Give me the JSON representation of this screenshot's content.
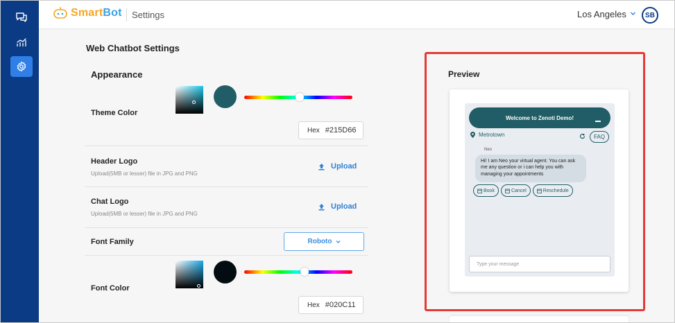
{
  "app": {
    "name_part1": "Smart",
    "name_part2": "Bot",
    "page": "Settings"
  },
  "topbar": {
    "location": "Los Angeles",
    "avatar_initials": "SB"
  },
  "sidebar": {
    "items": [
      {
        "icon": "chat-bubbles-icon",
        "active": false
      },
      {
        "icon": "analytics-chart-icon",
        "active": false
      },
      {
        "icon": "settings-gear-icon",
        "active": true
      }
    ]
  },
  "settings": {
    "title": "Web Chatbot Settings",
    "appearance_title": "Appearance",
    "theme_color": {
      "label": "Theme Color",
      "hex_label": "Hex",
      "hex_value": "#215D66",
      "swatch": "#215D66"
    },
    "header_logo": {
      "label": "Header Logo",
      "hint": "Upload(5MB or lesser) file in JPG and PNG",
      "button": "Upload"
    },
    "chat_logo": {
      "label": "Chat Logo",
      "hint": "Upload(5MB or lesser) file in JPG and PNG",
      "button": "Upload"
    },
    "font_family": {
      "label": "Font Family",
      "value": "Roboto"
    },
    "font_color": {
      "label": "Font Color",
      "hex_label": "Hex",
      "hex_value": "#020C11",
      "swatch": "#020C11"
    }
  },
  "preview": {
    "title": "Preview",
    "header_text": "Welcome to Zenoti Demo!",
    "location": "Metrotown",
    "faq": "FAQ",
    "agent_name": "Neo",
    "message": "Hi! I am Neo your virtual agent. You can ask me any question or i can help you with managing your appointments",
    "quick_replies": [
      "Book",
      "Cancel",
      "Reschedule"
    ],
    "input_placeholder": "Type your message"
  },
  "colors": {
    "rail": "#0b3b84",
    "accent": "#2f7fe6",
    "upload_blue": "#2a7fd4",
    "highlight_outline": "#e53935"
  }
}
